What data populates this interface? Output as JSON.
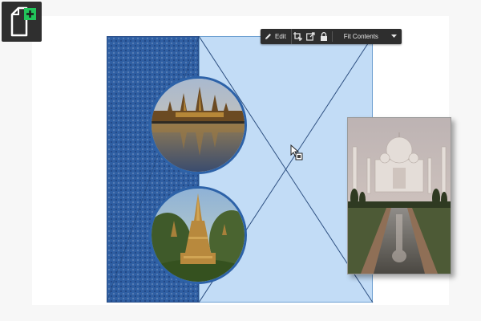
{
  "toolbar": {
    "edit_label": "Edit",
    "fit_label": "Fit Contents",
    "icons": [
      "pencil-icon",
      "crop-icon",
      "replace-image-icon",
      "lock-icon",
      "chevron-down-icon"
    ]
  },
  "add_page_tool": {
    "icon": "add-page-icon",
    "accent": "#21c45a"
  },
  "colors": {
    "panel_blue": "#2f5fa3",
    "frame_fill": "#c2dcf6",
    "frame_border": "#6d9fd1",
    "circle_border": "#2d62a8"
  }
}
